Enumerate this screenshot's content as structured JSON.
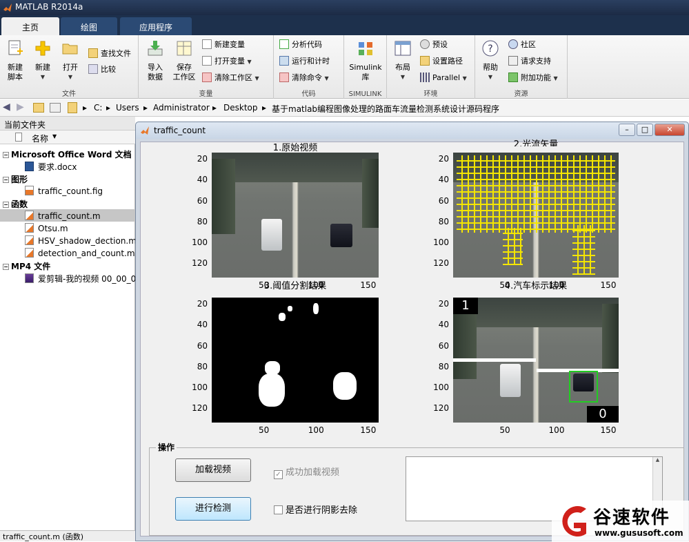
{
  "app": {
    "title": "MATLAB R2014a"
  },
  "tabs": [
    {
      "label": "主页"
    },
    {
      "label": "绘图"
    },
    {
      "label": "应用程序"
    }
  ],
  "ribbon": {
    "file": {
      "label": "文件",
      "new_script": "新建\n脚本",
      "new": "新建",
      "open": "打开",
      "find_files": "查找文件",
      "compare": "比较"
    },
    "variable": {
      "label": "变量",
      "import": "导入\n数据",
      "save_ws": "保存\n工作区",
      "new_var": "新建变量",
      "open_var": "打开变量",
      "clear_ws": "清除工作区"
    },
    "code": {
      "label": "代码",
      "analyze": "分析代码",
      "run_time": "运行和计时",
      "clear_cmd": "清除命令"
    },
    "simulink": {
      "label": "SIMULINK",
      "lib": "Simulink\n库"
    },
    "env": {
      "label": "环境",
      "layout": "布局",
      "prefs": "预设",
      "set_path": "设置路径",
      "parallel": "Parallel"
    },
    "resources": {
      "label": "资源",
      "help": "帮助",
      "community": "社区",
      "request_support": "请求支持",
      "addons": "附加功能"
    }
  },
  "address": {
    "drive": "C:",
    "parts": [
      "Users",
      "Administrator",
      "Desktop",
      "基于matlab编程图像处理的路面车流量检测系统设计源码程序"
    ]
  },
  "left_panel": {
    "title": "当前文件夹",
    "column": "名称",
    "groups": [
      {
        "name": "Microsoft Office Word 文档",
        "files": [
          "要求.docx"
        ]
      },
      {
        "name": "图形",
        "files": [
          "traffic_count.fig"
        ]
      },
      {
        "name": "函数",
        "files": [
          "traffic_count.m",
          "Otsu.m",
          "HSV_shadow_dection.m",
          "detection_and_count.m"
        ]
      },
      {
        "name": "MP4 文件",
        "files": [
          "爱剪辑-我的视频 00_00_0"
        ]
      }
    ],
    "status": "traffic_count.m (函数)"
  },
  "figure": {
    "title": "traffic_count",
    "axes": [
      {
        "title": "1.原始视频"
      },
      {
        "title": "2.光流矢量"
      },
      {
        "title": "3.阈值分割结果"
      },
      {
        "title": "4.汽车标示结果"
      }
    ],
    "yticks": [
      "20",
      "40",
      "60",
      "80",
      "100",
      "120"
    ],
    "xticks": [
      "50",
      "100",
      "150"
    ],
    "count_left": "1",
    "count_right": "0",
    "panel": {
      "label": "操作",
      "load_btn": "加载视频",
      "detect_btn": "进行检测",
      "loaded_chk": "成功加载视频",
      "shadow_chk": "是否进行阴影去除"
    }
  },
  "watermark": {
    "brand": "谷速软件",
    "url": "www.gususoft.com"
  },
  "colors": {
    "titlebar": "#1c2b45",
    "grid_yellow": "#f5e600",
    "box_green": "#22cc22"
  }
}
